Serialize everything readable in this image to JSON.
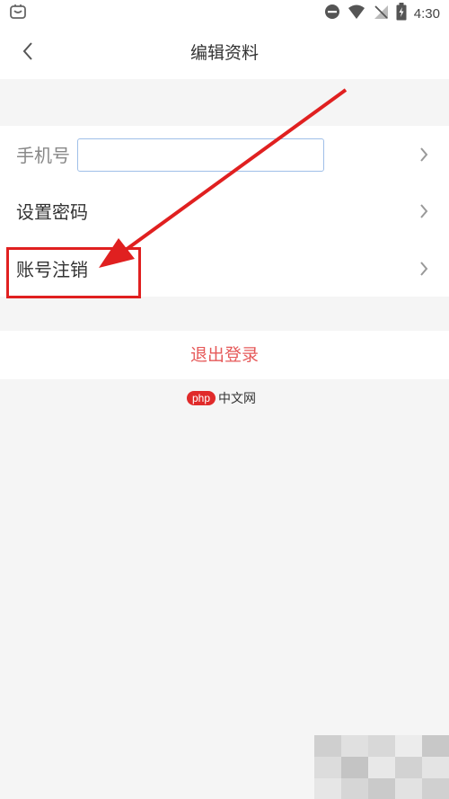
{
  "status_bar": {
    "time": "4:30",
    "icons": [
      "app-notification-icon",
      "dnd-icon",
      "wifi-icon",
      "no-signal-icon",
      "battery-icon"
    ]
  },
  "nav": {
    "back_icon": "chevron-left-icon",
    "title": "编辑资料"
  },
  "list": {
    "rows": [
      {
        "label": "手机号",
        "input_value": "",
        "chevron": "chevron-right-icon"
      },
      {
        "label": "设置密码",
        "chevron": "chevron-right-icon"
      },
      {
        "label": "账号注销",
        "chevron": "chevron-right-icon"
      }
    ]
  },
  "logout": {
    "label": "退出登录"
  },
  "watermark": {
    "badge": "php",
    "text": "中文网"
  },
  "colors": {
    "annotation_red": "#e02020",
    "logout_red": "#e65a5a",
    "background": "#f5f5f5",
    "input_border": "#9fbfe8"
  }
}
